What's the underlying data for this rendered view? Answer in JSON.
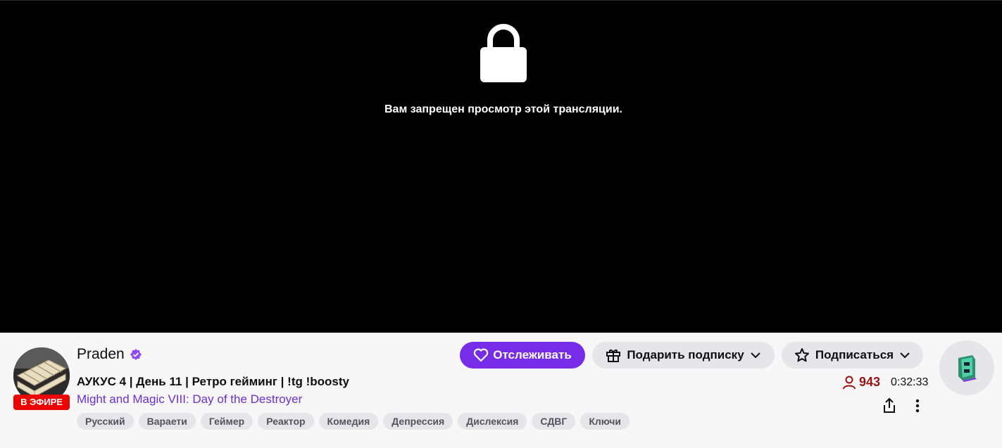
{
  "player": {
    "blocked_message": "Вам запрещен просмотр этой трансляции."
  },
  "channel": {
    "name": "Praden",
    "live_label": "В ЭФИРЕ",
    "stream_title": "АУКУС 4 | День 11 | Ретро гейминг | !tg !boosty",
    "game": "Might and Magic VIII: Day of the Destroyer",
    "tags": [
      "Русский",
      "Вараети",
      "Геймер",
      "Реактор",
      "Комедия",
      "Депрессия",
      "Дислексия",
      "СДВГ",
      "Ключи"
    ],
    "viewers": "943",
    "uptime": "0:32:33"
  },
  "actions": {
    "follow_label": "Отслеживать",
    "gift_label": "Подарить подписку",
    "subscribe_label": "Подписаться"
  },
  "colors": {
    "accent": "#772ce8",
    "live": "#eb0400",
    "viewers": "#971311"
  }
}
